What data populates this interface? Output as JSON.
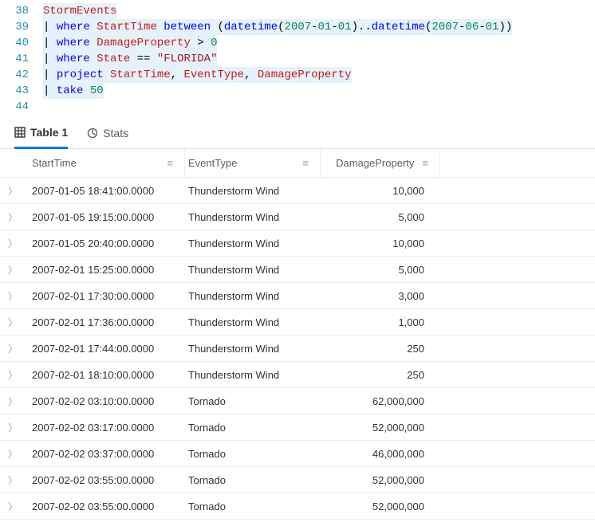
{
  "editor": {
    "lines": [
      {
        "num": "38",
        "hl": true,
        "tokens": [
          [
            "ident",
            "StormEvents"
          ]
        ]
      },
      {
        "num": "39",
        "hl": true,
        "tokens": [
          [
            "op",
            "| "
          ],
          [
            "kw",
            "where"
          ],
          [
            "op",
            " "
          ],
          [
            "ident",
            "StartTime"
          ],
          [
            "op",
            " "
          ],
          [
            "kw",
            "between"
          ],
          [
            "op",
            " ("
          ],
          [
            "kw",
            "datetime"
          ],
          [
            "op",
            "("
          ],
          [
            "num",
            "2007"
          ],
          [
            "op",
            "-"
          ],
          [
            "num",
            "01"
          ],
          [
            "op",
            "-"
          ],
          [
            "num",
            "01"
          ],
          [
            "op",
            ").."
          ],
          [
            "kw",
            "datetime"
          ],
          [
            "op",
            "("
          ],
          [
            "num",
            "2007"
          ],
          [
            "op",
            "-"
          ],
          [
            "num",
            "06"
          ],
          [
            "op",
            "-"
          ],
          [
            "num",
            "01"
          ],
          [
            "op",
            "))"
          ]
        ]
      },
      {
        "num": "40",
        "hl": true,
        "tokens": [
          [
            "op",
            "| "
          ],
          [
            "kw",
            "where"
          ],
          [
            "op",
            " "
          ],
          [
            "ident",
            "DamageProperty"
          ],
          [
            "op",
            " > "
          ],
          [
            "num",
            "0"
          ]
        ]
      },
      {
        "num": "41",
        "hl": true,
        "tokens": [
          [
            "op",
            "| "
          ],
          [
            "kw",
            "where"
          ],
          [
            "op",
            " "
          ],
          [
            "ident",
            "State"
          ],
          [
            "op",
            " == "
          ],
          [
            "str",
            "\"FLORIDA\""
          ]
        ]
      },
      {
        "num": "42",
        "hl": true,
        "tokens": [
          [
            "op",
            "| "
          ],
          [
            "kw",
            "project"
          ],
          [
            "op",
            " "
          ],
          [
            "ident",
            "StartTime"
          ],
          [
            "op",
            ", "
          ],
          [
            "ident",
            "EventType"
          ],
          [
            "op",
            ", "
          ],
          [
            "ident",
            "DamageProperty"
          ]
        ]
      },
      {
        "num": "43",
        "hl": true,
        "tokens": [
          [
            "op",
            "| "
          ],
          [
            "kw",
            "take"
          ],
          [
            "op",
            " "
          ],
          [
            "num",
            "50"
          ]
        ]
      },
      {
        "num": "44",
        "hl": false,
        "tokens": []
      }
    ]
  },
  "tabs": {
    "table": "Table 1",
    "stats": "Stats"
  },
  "grid": {
    "headers": {
      "start": "StartTime",
      "event": "EventType",
      "damage": "DamageProperty"
    },
    "rows": [
      {
        "start": "2007-01-05 18:41:00.0000",
        "event": "Thunderstorm Wind",
        "damage": "10,000"
      },
      {
        "start": "2007-01-05 19:15:00.0000",
        "event": "Thunderstorm Wind",
        "damage": "5,000"
      },
      {
        "start": "2007-01-05 20:40:00.0000",
        "event": "Thunderstorm Wind",
        "damage": "10,000"
      },
      {
        "start": "2007-02-01 15:25:00.0000",
        "event": "Thunderstorm Wind",
        "damage": "5,000"
      },
      {
        "start": "2007-02-01 17:30:00.0000",
        "event": "Thunderstorm Wind",
        "damage": "3,000"
      },
      {
        "start": "2007-02-01 17:36:00.0000",
        "event": "Thunderstorm Wind",
        "damage": "1,000"
      },
      {
        "start": "2007-02-01 17:44:00.0000",
        "event": "Thunderstorm Wind",
        "damage": "250"
      },
      {
        "start": "2007-02-01 18:10:00.0000",
        "event": "Thunderstorm Wind",
        "damage": "250"
      },
      {
        "start": "2007-02-02 03:10:00.0000",
        "event": "Tornado",
        "damage": "62,000,000"
      },
      {
        "start": "2007-02-02 03:17:00.0000",
        "event": "Tornado",
        "damage": "52,000,000"
      },
      {
        "start": "2007-02-02 03:37:00.0000",
        "event": "Tornado",
        "damage": "46,000,000"
      },
      {
        "start": "2007-02-02 03:55:00.0000",
        "event": "Tornado",
        "damage": "52,000,000"
      },
      {
        "start": "2007-02-02 03:55:00.0000",
        "event": "Tornado",
        "damage": "52,000,000"
      }
    ]
  }
}
